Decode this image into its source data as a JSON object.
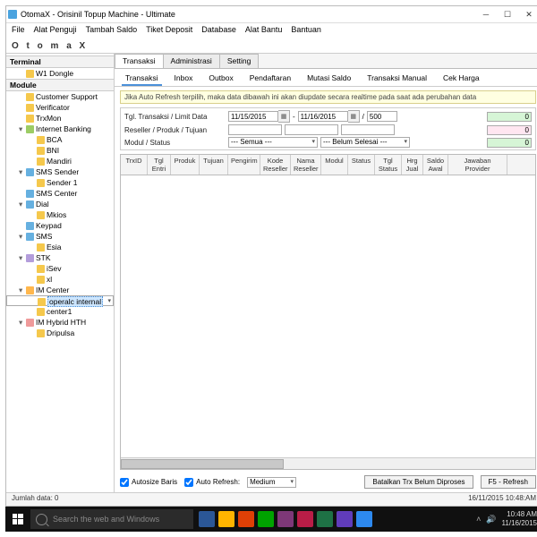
{
  "title": "OtomaX - Orisinil Topup Machine - Ultimate",
  "menu": [
    "File",
    "Alat Penguji",
    "Tambah Saldo",
    "Tiket Deposit",
    "Database",
    "Alat Bantu",
    "Bantuan"
  ],
  "brand": "O t o m a X",
  "treeHdr1": "Terminal",
  "treeHdr2": "Module",
  "tree1": [
    {
      "label": "W1 Dongle"
    }
  ],
  "tree2": [
    {
      "label": "Customer Support",
      "cls": "i-y"
    },
    {
      "label": "Verificator",
      "cls": "i-y"
    },
    {
      "label": "TrxMon",
      "cls": "i-y"
    },
    {
      "label": "Internet Banking",
      "cls": "i-g",
      "children": [
        "BCA",
        "BNI",
        "Mandiri"
      ]
    },
    {
      "label": "SMS Sender",
      "cls": "i-b",
      "children": [
        "Sender 1"
      ]
    },
    {
      "label": "SMS Center",
      "cls": "i-b"
    },
    {
      "label": "Dial",
      "cls": "i-b",
      "children": [
        "Mkios"
      ]
    },
    {
      "label": "Keypad",
      "cls": "i-b"
    },
    {
      "label": "SMS",
      "cls": "i-b",
      "children": [
        "Esia"
      ]
    },
    {
      "label": "STK",
      "cls": "i-p",
      "children": [
        "iSev",
        "xl"
      ]
    },
    {
      "label": "IM Center",
      "cls": "i-o",
      "children": [
        {
          "label": "operalc internal",
          "sel": true
        },
        {
          "label": "center1"
        }
      ]
    },
    {
      "label": "IM Hybrid HTH",
      "cls": "i-r",
      "children": [
        "Dripulsa"
      ]
    }
  ],
  "outerTabs": [
    "Transaksi",
    "Administrasi",
    "Setting"
  ],
  "innerTabs": [
    "Transaksi",
    "Inbox",
    "Outbox",
    "Pendaftaran",
    "Mutasi Saldo",
    "Transaksi Manual",
    "Cek Harga"
  ],
  "note": "Jika Auto Refresh terpilih, maka data dibawah ini akan diupdate secara realtime pada saat ada perubahan data",
  "filters": {
    "dateLabel": "Tgl. Transaksi / Limit Data",
    "date1": "11/15/2015",
    "date2": "11/16/2015",
    "limit": "500",
    "resLabel": "Reseller / Produk / Tujuan",
    "modLabel": "Modul / Status",
    "modSel": "--- Semua ---",
    "statSel": "--- Belum Selesai ---",
    "num1": "0",
    "num2": "0",
    "num3": "0"
  },
  "cols": [
    "TrxID",
    "Tgl Entri",
    "Produk",
    "Tujuan",
    "Pengirim",
    "Kode Reseller",
    "Nama Reseller",
    "Modul",
    "Status",
    "Tgl Status",
    "Hrg Jual",
    "Saldo Awal",
    "Jawaban Provider"
  ],
  "footer": {
    "autosize": "Autosize Baris",
    "autorefresh": "Auto Refresh:",
    "refSel": "Medium",
    "btn1": "Batalkan Trx Belum Diproses",
    "btn2": "F5 - Refresh"
  },
  "status": {
    "left": "Jumlah data: 0",
    "right": "16/11/2015 10:48:AM"
  },
  "taskbar": {
    "search": "Search the web and Windows",
    "time": "10:48 AM",
    "date": "11/16/2015",
    "iconColors": [
      "#2b5797",
      "#ffb400",
      "#e04006",
      "#00a300",
      "#7e3878",
      "#b91d47",
      "#1e7145",
      "#603cba",
      "#2d89ef"
    ]
  }
}
